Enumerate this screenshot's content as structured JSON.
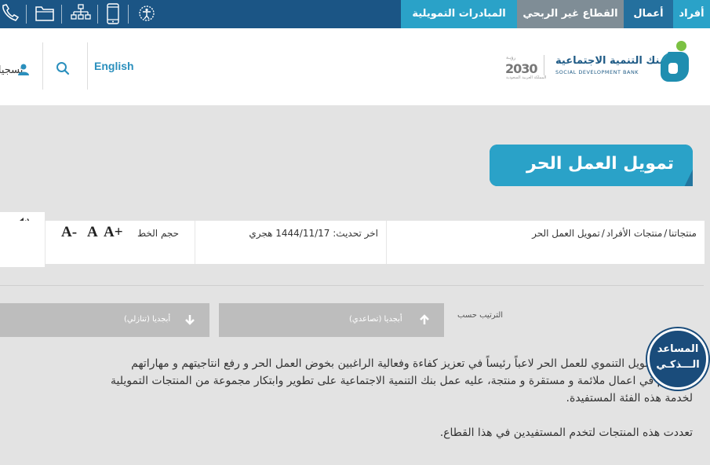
{
  "nav": {
    "tabs": [
      {
        "label": "أفراد"
      },
      {
        "label": "أعمال"
      },
      {
        "label": "القطاع غير الربحي"
      },
      {
        "label": "المبادرات التمويلية"
      }
    ],
    "icons": [
      "phone-icon",
      "folder-icon",
      "sitemap-icon",
      "mobile-icon",
      "accessibility-icon"
    ]
  },
  "header": {
    "logo_ar": "بنك التنمية الاجتماعية",
    "logo_en": "SOCIAL DEVELOPMENT BANK",
    "vision_top": "رؤيـة",
    "vision_num": "2030",
    "vision_sub": "المملكة العربية السعودية",
    "english_label": "English",
    "user_label": "تسجيل"
  },
  "page": {
    "title": "تمويل العمل الحر",
    "breadcrumb": [
      "منتجاتنا",
      "منتجات الأفراد",
      "تمويل العمل الحر"
    ],
    "last_updated": "اخر تحديث: 1444/11/17 هجري",
    "font_size_label": "حجم الخط",
    "font_buttons": [
      "A+",
      "A",
      "A-"
    ]
  },
  "sort": {
    "label": "الترتيب حسب",
    "asc_label": "أبجديا (تصاعدي)",
    "desc_label": "أبجديا (تنازلي)"
  },
  "assistant": {
    "line1": "المساعد",
    "line2": "الـــذكـي"
  },
  "content": {
    "p1_line1": "ويلعب التمويل التنموي للعمل الحر لاعباً رئيساً في تعزيز كفاءة وفعالية الراغبين بخوض العمل الحر و رفع انتاجيتهم و مهاراتهم",
    "p1_line2": "ودمجهم في اعمال ملائمة و مستقرة و منتجة، عليه عمل بنك التنمية الاجتماعية على تطوير وابتكار مجموعة من المنتجات التمويلية",
    "p1_line3": "لخدمة هذه الفئة المستفيدة.",
    "p2": "تعددت هذه المنتجات لتخدم المستفيدين في هذا القطاع."
  },
  "colors": {
    "topbar": "#1b5585",
    "accent": "#2aa2c8",
    "assistant": "#1a4c7b"
  }
}
